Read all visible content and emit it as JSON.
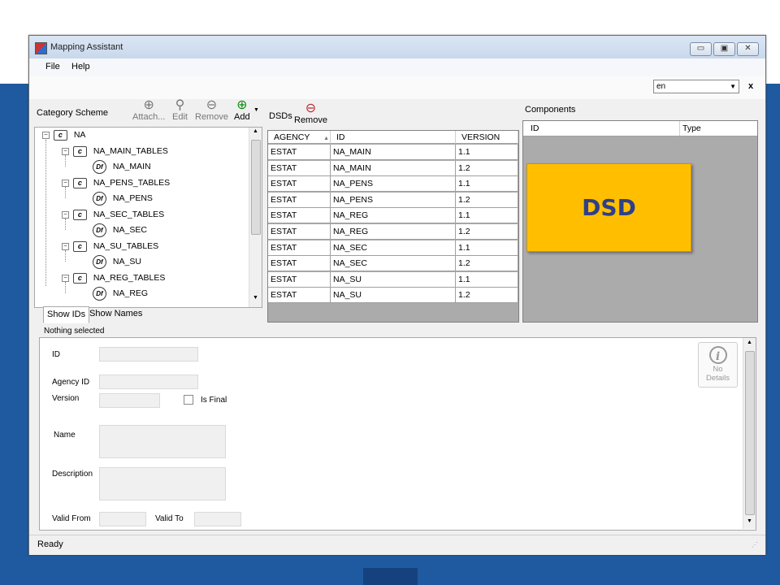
{
  "window": {
    "title": "Mapping Assistant",
    "buttons": {
      "minimize": "▭",
      "maximize": "▣",
      "close": "✕"
    }
  },
  "menu": {
    "items": [
      "File",
      "Help"
    ]
  },
  "language": {
    "value": "en",
    "close": "x"
  },
  "category_scheme": {
    "title": "Category Scheme",
    "tools": [
      {
        "label": "Attach...",
        "icon": "attach-plus-icon",
        "enabled": false
      },
      {
        "label": "Edit",
        "icon": "magnifier-icon",
        "enabled": false
      },
      {
        "label": "Remove",
        "icon": "minus-circle-icon",
        "enabled": false
      },
      {
        "label": "Add",
        "icon": "plus-circle-icon",
        "enabled": true
      }
    ],
    "tree": [
      {
        "label": "NA",
        "type": "category",
        "level": 0,
        "icon": "c"
      },
      {
        "label": "NA_MAIN_TABLES",
        "type": "category",
        "level": 1,
        "icon": "c"
      },
      {
        "label": "NA_MAIN",
        "type": "dataflow",
        "level": 2,
        "icon": "Df"
      },
      {
        "label": "NA_PENS_TABLES",
        "type": "category",
        "level": 1,
        "icon": "c"
      },
      {
        "label": "NA_PENS",
        "type": "dataflow",
        "level": 2,
        "icon": "Df"
      },
      {
        "label": "NA_SEC_TABLES",
        "type": "category",
        "level": 1,
        "icon": "c"
      },
      {
        "label": "NA_SEC",
        "type": "dataflow",
        "level": 2,
        "icon": "Df"
      },
      {
        "label": "NA_SU_TABLES",
        "type": "category",
        "level": 1,
        "icon": "c"
      },
      {
        "label": "NA_SU",
        "type": "dataflow",
        "level": 2,
        "icon": "Df"
      },
      {
        "label": "NA_REG_TABLES",
        "type": "category",
        "level": 1,
        "icon": "c"
      },
      {
        "label": "NA_REG",
        "type": "dataflow",
        "level": 2,
        "icon": "Df"
      }
    ],
    "tabs": [
      "Show IDs",
      "Show Names"
    ],
    "selected_tab": "Show IDs"
  },
  "dsds": {
    "title": "DSDs",
    "remove_label": "Remove",
    "columns": [
      "AGENCY",
      "ID",
      "VERSION"
    ],
    "rows": [
      [
        "ESTAT",
        "NA_MAIN",
        "1.1"
      ],
      [
        "ESTAT",
        "NA_MAIN",
        "1.2"
      ],
      [
        "ESTAT",
        "NA_PENS",
        "1.1"
      ],
      [
        "ESTAT",
        "NA_PENS",
        "1.2"
      ],
      [
        "ESTAT",
        "NA_REG",
        "1.1"
      ],
      [
        "ESTAT",
        "NA_REG",
        "1.2"
      ],
      [
        "ESTAT",
        "NA_SEC",
        "1.1"
      ],
      [
        "ESTAT",
        "NA_SEC",
        "1.2"
      ],
      [
        "ESTAT",
        "NA_SU",
        "1.1"
      ],
      [
        "ESTAT",
        "NA_SU",
        "1.2"
      ]
    ]
  },
  "components": {
    "title": "Components",
    "columns": [
      "ID",
      "Type"
    ]
  },
  "callout": {
    "text": "DSD",
    "color": "#ffbf00"
  },
  "details": {
    "header": "Nothing selected",
    "labels": {
      "id": "ID",
      "agency_id": "Agency ID",
      "version": "Version",
      "is_final": "Is Final",
      "name": "Name",
      "description": "Description",
      "valid_from": "Valid From",
      "valid_to": "Valid To"
    },
    "no_details": {
      "line1": "No",
      "line2": "Details",
      "icon": "info-icon"
    }
  },
  "status": {
    "text": "Ready"
  }
}
